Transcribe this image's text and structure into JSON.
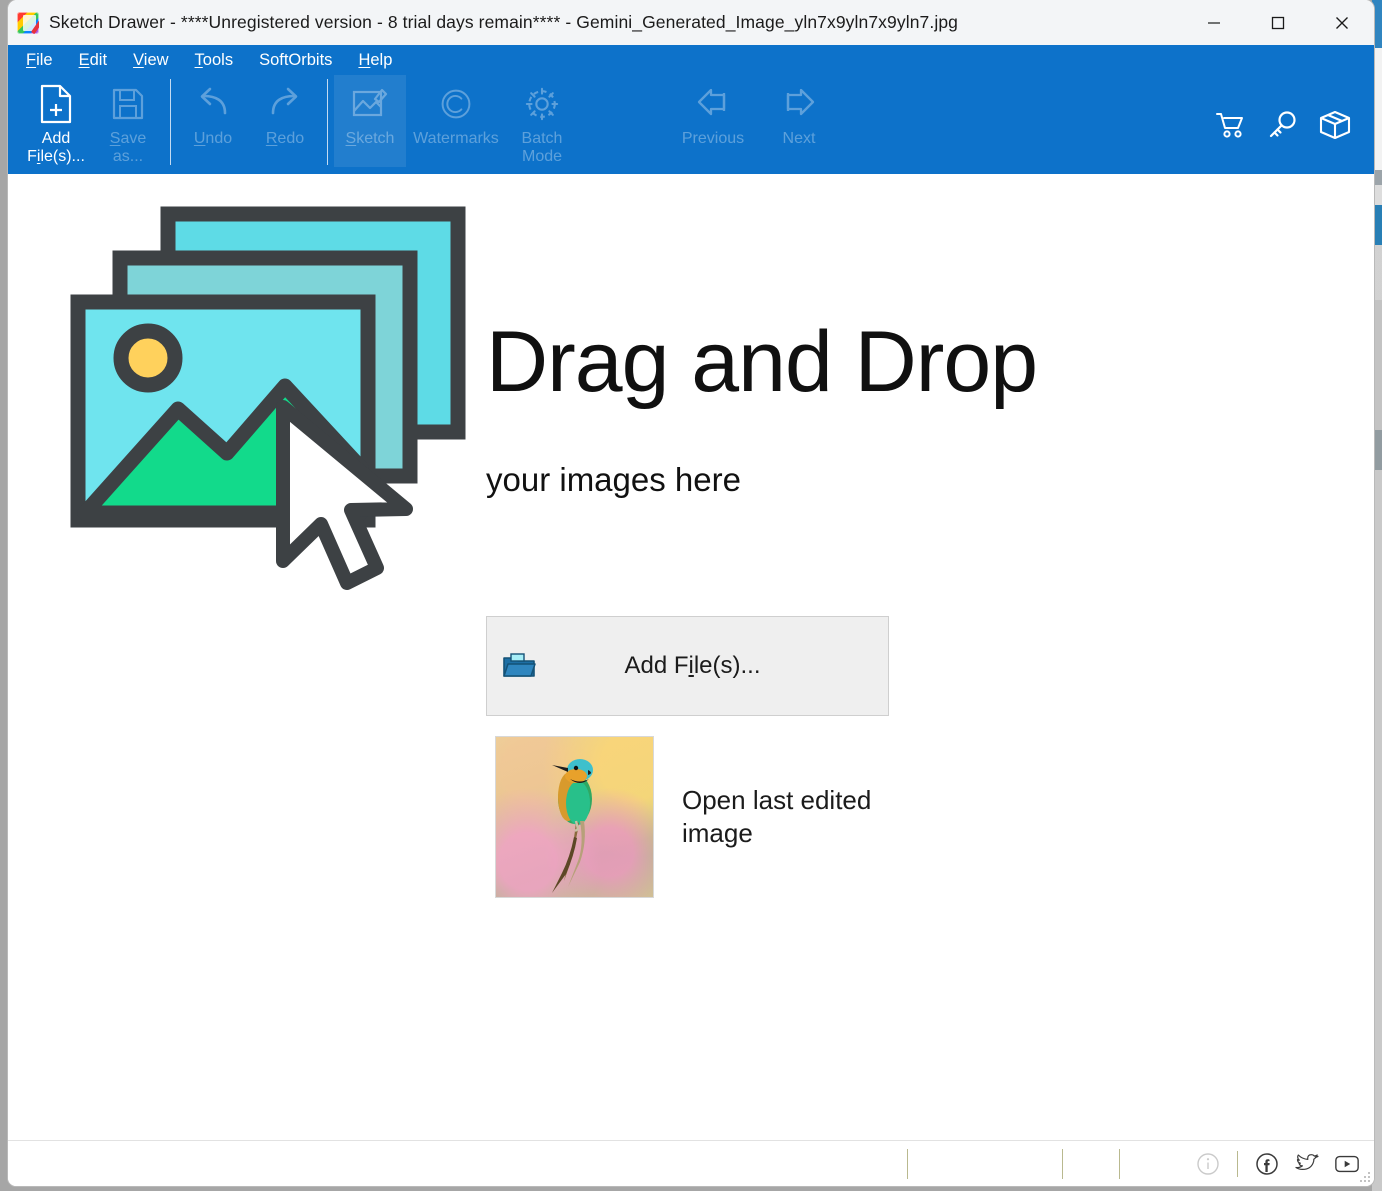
{
  "window": {
    "title": "Sketch Drawer - ****Unregistered version - 8 trial days remain**** - Gemini_Generated_Image_yln7x9yln7x9yln7.jpg",
    "app_icon": "sketch-drawer-logo-icon",
    "controls": {
      "minimize": "minimize-icon",
      "maximize": "maximize-icon",
      "close": "close-icon"
    }
  },
  "menubar": {
    "items": [
      {
        "label": "File",
        "accel_prefix": "F",
        "accel_rest": "ile"
      },
      {
        "label": "Edit",
        "accel_prefix": "E",
        "accel_rest": "dit"
      },
      {
        "label": "View",
        "accel_prefix": "V",
        "accel_rest": "iew"
      },
      {
        "label": "Tools",
        "accel_prefix": "T",
        "accel_rest": "ools"
      },
      {
        "label": "SoftOrbits",
        "accel_prefix": "",
        "accel_rest": "SoftOrbits"
      },
      {
        "label": "Help",
        "accel_prefix": "H",
        "accel_rest": "elp"
      }
    ]
  },
  "toolbar": {
    "add_files": {
      "line1": "Add",
      "line2_pre": "F",
      "line2_key": "i",
      "line2_post": "le(s)...",
      "icon": "add-file-icon",
      "enabled": true
    },
    "save_as": {
      "line1_key": "S",
      "line1_post": "ave",
      "line2": "as...",
      "icon": "save-icon",
      "enabled": false
    },
    "undo": {
      "key": "U",
      "rest": "ndo",
      "icon": "undo-arrow-icon",
      "enabled": false
    },
    "redo": {
      "key": "R",
      "rest": "edo",
      "icon": "redo-arrow-icon",
      "enabled": false
    },
    "sketch": {
      "key": "S",
      "rest": "ketch",
      "icon": "sketch-pencil-image-icon",
      "enabled": false
    },
    "watermarks": {
      "label": "Watermarks",
      "icon": "copyright-icon",
      "enabled": false
    },
    "batch_mode": {
      "line1": "Batch",
      "line2": "Mode",
      "icon": "gear-icon",
      "enabled": false
    },
    "previous": {
      "label": "Previous",
      "icon": "arrow-left-icon",
      "enabled": false
    },
    "next": {
      "label": "Next",
      "icon": "arrow-right-icon",
      "enabled": false
    },
    "right_icons": [
      {
        "name": "shopping-cart-icon",
        "title": "Buy"
      },
      {
        "name": "key-icon",
        "title": "Register"
      },
      {
        "name": "box-package-icon",
        "title": "Products"
      }
    ]
  },
  "content": {
    "headline": "Drag and Drop",
    "subline": "your images here",
    "illustration_icon": "drag-drop-images-cursor-illustration",
    "add_files_button": {
      "pre": "Add F",
      "key": "i",
      "post": "le(s)...",
      "icon": "folder-open-icon"
    },
    "recent": {
      "label": "Open last edited image",
      "thumbnail_icon": "bee-eater-bird-thumbnail"
    }
  },
  "statusbar": {
    "panes": [
      "",
      "",
      ""
    ],
    "icons": [
      {
        "name": "info-icon",
        "glyph": "i"
      },
      {
        "name": "facebook-icon",
        "glyph": "f"
      },
      {
        "name": "twitter-icon",
        "glyph": "t"
      },
      {
        "name": "youtube-icon",
        "glyph": "y"
      }
    ]
  },
  "colors": {
    "ribbon_blue": "#0d72ca",
    "titlebar_bg": "#f3f5f7",
    "button_bg": "#efefef",
    "illustration_cyan": "#6fe4ee",
    "illustration_green": "#12da8b",
    "illustration_sun": "#ffd15c",
    "illustration_outline": "#3d4144"
  }
}
